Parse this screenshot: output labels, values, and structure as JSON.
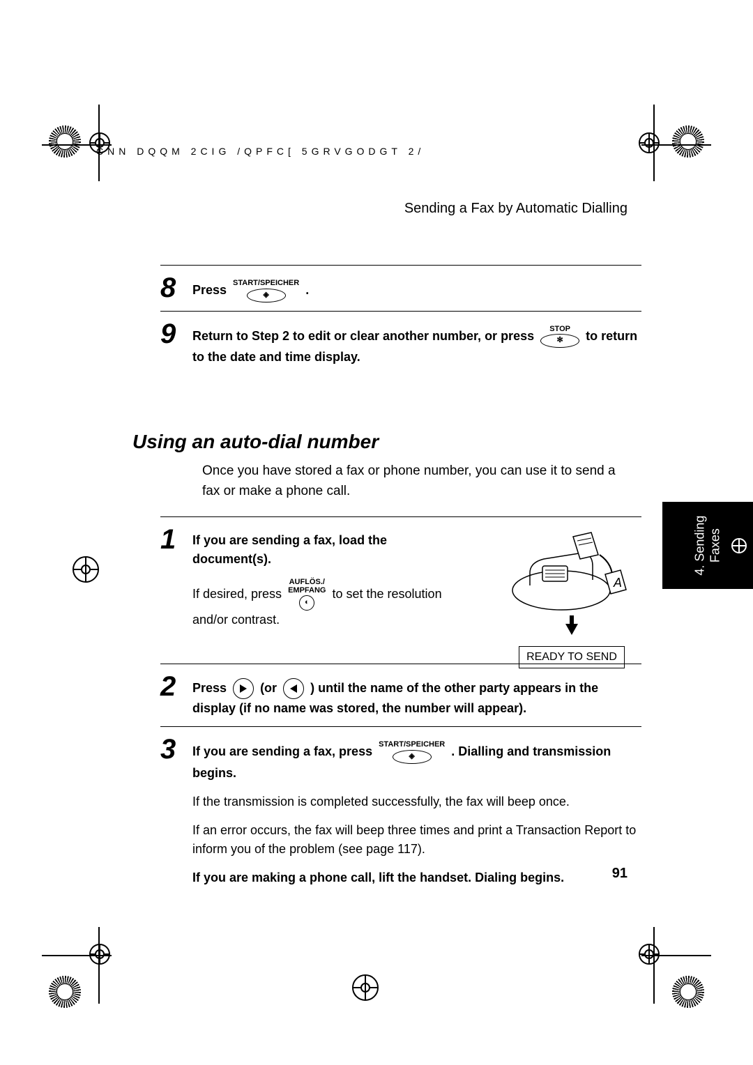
{
  "header_code": "CNN DQQM  2CIG    /QPFC[  5GRVGODGT                          2/",
  "section_title": "Sending a Fax by Automatic Dialling",
  "step8": {
    "num": "8",
    "text_a": "Press ",
    "btn_label": "START/SPEICHER",
    "text_b": "."
  },
  "step9": {
    "num": "9",
    "text_a": "Return to Step 2 to edit or clear another number, or press ",
    "btn_label": "STOP",
    "text_b": " to return to the date and time display."
  },
  "h2": "Using an auto-dial number",
  "intro": "Once you have stored a fax or phone number, you can use it to send a fax or make a phone call.",
  "side_tab": "4. Sending\nFaxes",
  "stepA1": {
    "num": "1",
    "bold_a": "If you are sending a fax, load the document(s).",
    "plain_a": "If desired, press ",
    "btn_top": "AUFLÖS./",
    "btn_bot": "EMPFANG",
    "plain_b": " to set the resolution and/or contrast.",
    "lcd": "READY TO SEND"
  },
  "stepA2": {
    "num": "2",
    "text_a": "Press ",
    "text_b": " (or ",
    "text_c": " ) until the name of the other party appears in the display (if no name was stored, the number will appear)."
  },
  "stepA3": {
    "num": "3",
    "bold_a": "If you are sending a fax, press ",
    "btn_label": "START/SPEICHER",
    "bold_b": ". Dialling and transmission begins.",
    "plain_a": "If the transmission is completed successfully, the fax will beep once.",
    "plain_b": "If an error occurs, the fax will beep three times and print a Transaction Report to inform you of the problem (see page 117).",
    "bold_c": "If you are making a phone call, lift the handset. Dialing begins."
  },
  "page_number": "91",
  "btn_symbol_start": "◈",
  "btn_symbol_stop": "✻"
}
